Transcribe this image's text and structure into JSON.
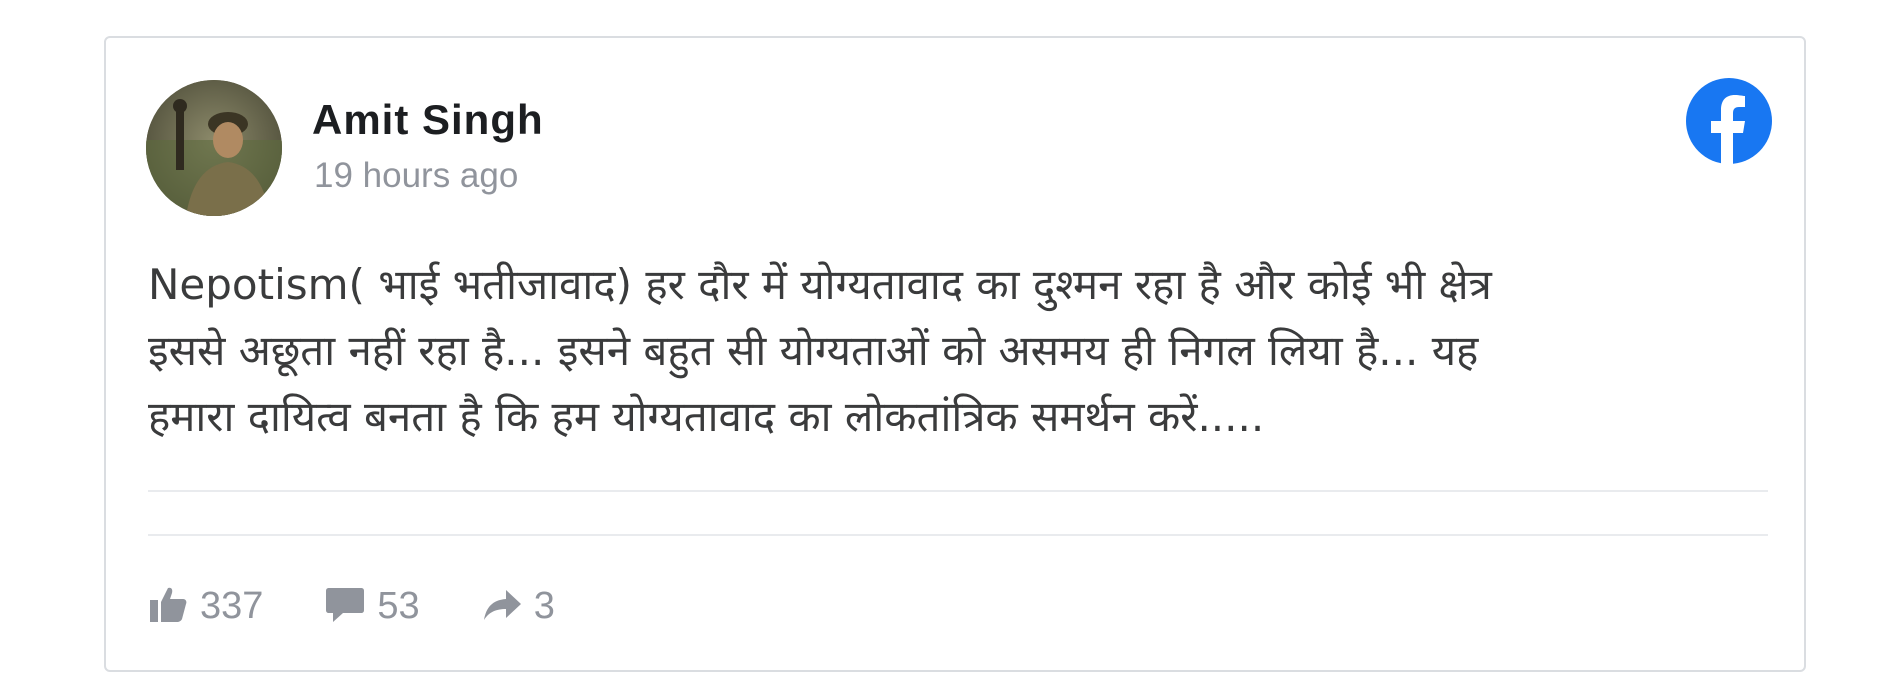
{
  "post": {
    "author": "Amit Singh",
    "time": "19 hours ago",
    "text_lines": [
      "Nepotism( भाई भतीजावाद) हर दौर में योग्यतावाद का दुश्मन रहा है और कोई भी क्षेत्र",
      "इससे अछूता नहीं रहा है... इसने बहुत सी योग्यताओं को असमय ही निगल लिया है... यह",
      "हमारा दायित्व बनता है कि हम योग्यतावाद का लोकतांत्रिक समर्थन करें....."
    ],
    "likes": "337",
    "comments": "53",
    "shares": "3"
  },
  "icons": {
    "brand": "facebook-logo-icon",
    "like": "thumbs-up-icon",
    "comment": "comment-bubble-icon",
    "share": "share-arrow-icon"
  },
  "colors": {
    "facebook_blue": "#1877f2",
    "muted_text": "#90949c",
    "border": "#dadde1"
  }
}
